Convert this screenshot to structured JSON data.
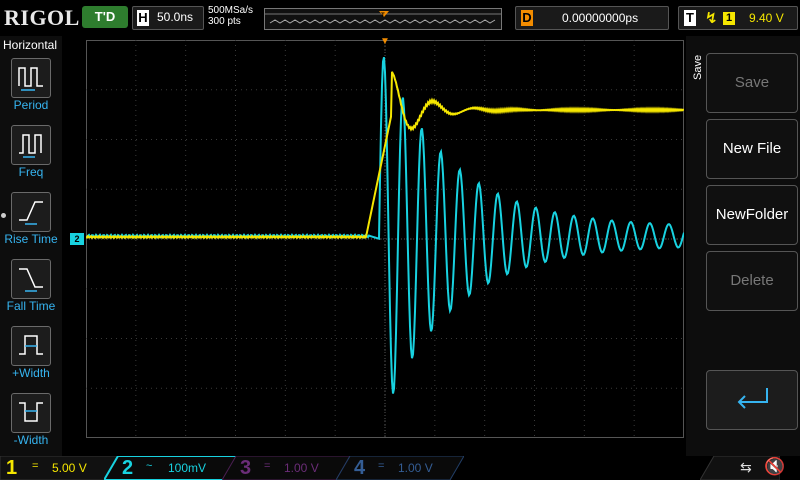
{
  "brand": "RIGOL",
  "top": {
    "run_status": "T'D",
    "horizontal_label": "H",
    "timebase": "50.0ns",
    "sample_rate": "500MSa/s",
    "points": "300 pts",
    "delay_label": "D",
    "delay_value": "0.00000000ps",
    "trigger_label": "T",
    "trigger_source": "1",
    "trigger_level": "9.40 V"
  },
  "left_menu": {
    "title": "Horizontal",
    "items": [
      {
        "label": "Period",
        "icon": "period-icon"
      },
      {
        "label": "Freq",
        "icon": "frequency-icon"
      },
      {
        "label": "Rise Time",
        "icon": "rise-time-icon"
      },
      {
        "label": "Fall Time",
        "icon": "fall-time-icon"
      },
      {
        "label": "+Width",
        "icon": "positive-width-icon"
      },
      {
        "label": "-Width",
        "icon": "negative-width-icon"
      }
    ]
  },
  "right_menu": {
    "title": "Save",
    "buttons": [
      {
        "label": "Save",
        "enabled": false
      },
      {
        "label": "New File",
        "enabled": true
      },
      {
        "label": "NewFolder",
        "enabled": true
      },
      {
        "label": "Delete",
        "enabled": false
      },
      {
        "label": "",
        "icon": "enter-icon",
        "enabled": true
      }
    ]
  },
  "channels": [
    {
      "num": "1",
      "coupling": "=",
      "scale": "5.00 V",
      "color": "#f5e600",
      "active": true
    },
    {
      "num": "2",
      "coupling": "~",
      "scale": "100mV",
      "color": "#18d2e0",
      "active": true
    },
    {
      "num": "3",
      "coupling": "=",
      "scale": "1.00 V",
      "color": "#b040c0",
      "active": false
    },
    {
      "num": "4",
      "coupling": "=",
      "scale": "1.00 V",
      "color": "#3f7fe0",
      "active": false
    }
  ],
  "markers": {
    "channel2": "2",
    "trigger": "T"
  },
  "colors": {
    "ch1": "#f5e600",
    "ch2": "#18d2e0",
    "accent": "#f28c00",
    "menu_text": "#36b4f0"
  }
}
